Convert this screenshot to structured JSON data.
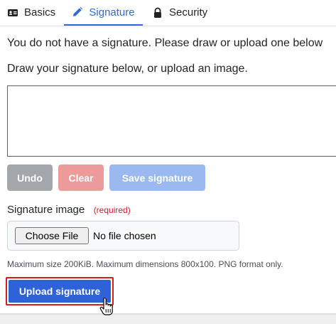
{
  "tabs": [
    {
      "label": "Basics",
      "icon": "id-card-icon"
    },
    {
      "label": "Signature",
      "icon": "pencil-icon",
      "active": true
    },
    {
      "label": "Security",
      "icon": "lock-icon"
    }
  ],
  "messages": {
    "no_signature": "You do not have a signature. Please draw or upload one below",
    "instructions": "Draw your signature below, or upload an image."
  },
  "buttons": {
    "undo": "Undo",
    "clear": "Clear",
    "save": "Save signature",
    "upload": "Upload signature"
  },
  "signature_image": {
    "label": "Signature image",
    "required": "(required)",
    "choose_file": "Choose File",
    "file_status": "No file chosen",
    "help": "Maximum size 200KiB. Maximum dimensions 800x100. PNG format only."
  },
  "colors": {
    "accent": "#2f6ad8",
    "undo": "#a3a6aa",
    "clear": "#ec9a9a",
    "save": "#9bb9f1",
    "upload": "#2e63d8",
    "required": "#d11a2a",
    "highlight": "#d21d1d"
  }
}
